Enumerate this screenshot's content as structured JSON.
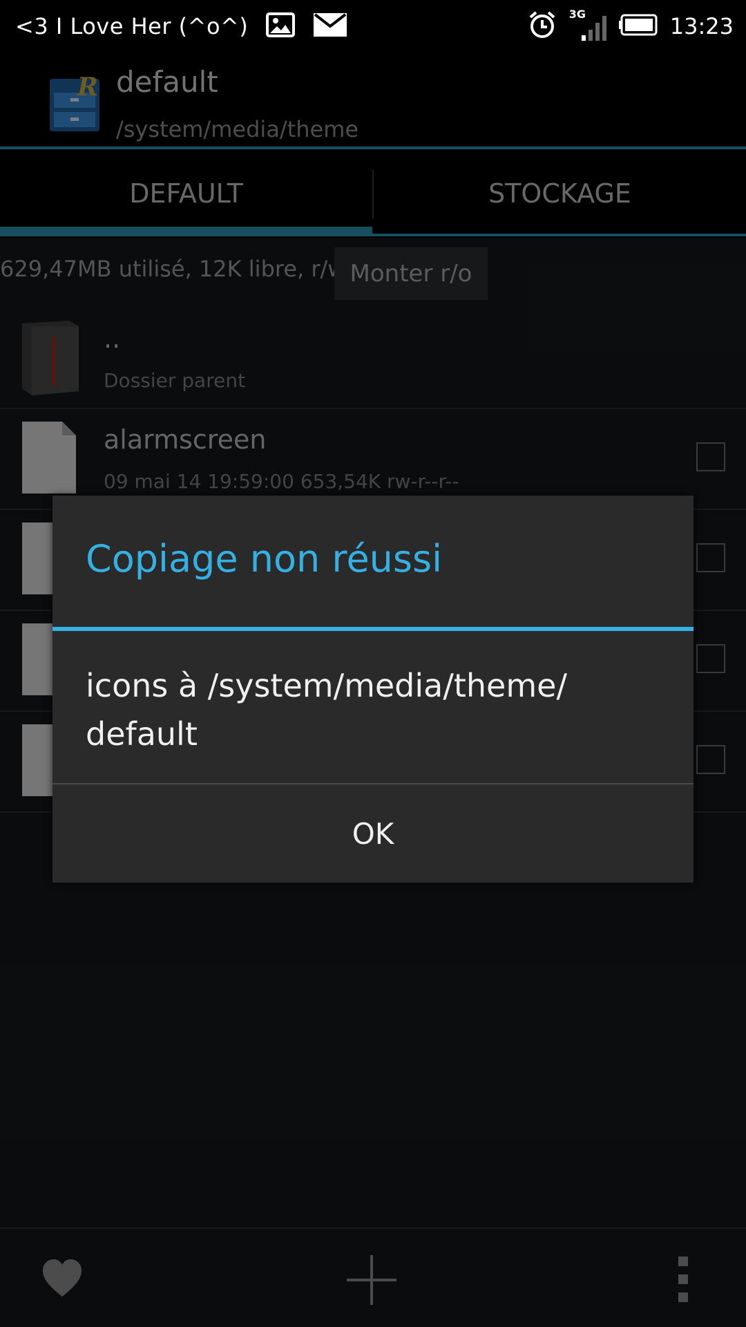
{
  "status_bar": {
    "notification_text": "<3 I Love Her (^o^)",
    "network": "3G",
    "time": "13:23"
  },
  "app_bar": {
    "title": "default",
    "path": "/system/media/theme"
  },
  "tabs": [
    {
      "label": "DEFAULT",
      "active": true
    },
    {
      "label": "STOCKAGE",
      "active": false
    }
  ],
  "storage": {
    "info": "629,47MB utilisé, 12K libre, r/w",
    "mount_button": "Monter r/o"
  },
  "files": [
    {
      "name": "..",
      "meta": "Dossier parent",
      "type": "folder"
    },
    {
      "name": "alarmscreen",
      "meta": "09 mai 14 19:59:00  653,54K  rw-r--r--",
      "type": "file"
    }
  ],
  "dialog": {
    "title": "Copiage non réussi",
    "message": "icons à /system/media/theme/ default",
    "ok_label": "OK"
  },
  "colors": {
    "accent": "#35b0e3",
    "tab_accent": "#2b8fb2",
    "background": "#15171b",
    "dialog_bg": "#2a2a2b"
  },
  "icons": {
    "favorite": "heart-icon",
    "add": "plus-icon",
    "more": "overflow-menu-icon"
  }
}
